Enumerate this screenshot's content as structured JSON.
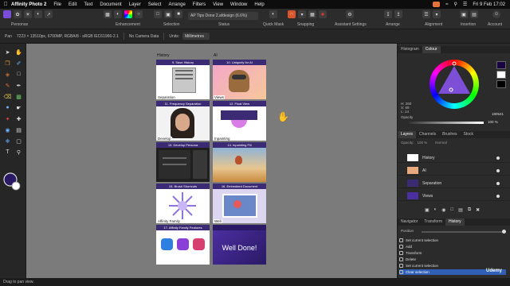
{
  "menubar": {
    "app_name": "Affinity Photo 2",
    "items": [
      "File",
      "Edit",
      "Text",
      "Document",
      "Layer",
      "Select",
      "Arrange",
      "Filters",
      "View",
      "Window",
      "Help"
    ],
    "datetime": "Fri 9 Feb  17:02"
  },
  "toolbar": {
    "personas_label": "Personas",
    "enhancement_label": "Enhancement",
    "selection_label": "Selection",
    "status_label": "Status",
    "quick_mask_label": "Quick Mask",
    "snapping_label": "Snapping",
    "assistant_label": "Assistant Settings",
    "arrange_label": "Arrange",
    "alignment_label": "Alignment",
    "insertion_label": "Insertion",
    "account_label": "Account",
    "document_status": "AP Tips Done 2.afdesign (6.6%)"
  },
  "context": {
    "tool": "Pan",
    "doc_info": "7223 × 13510px, 6700MP, RGBA/8 - sRGB IEC61966-2.1",
    "camera": "No Camera Data",
    "units_label": "Units:",
    "units_value": "Millimetres"
  },
  "canvas": {
    "columns": [
      "History",
      "AI"
    ],
    "cards": [
      {
        "header": "9. Save History",
        "caption": "Separation"
      },
      {
        "header": "10. Uniquely for AI",
        "caption": "Views"
      },
      {
        "header": "11. Frequency Separation",
        "caption": "Develop"
      },
      {
        "header": "12. Float View",
        "caption": "Inpainting"
      },
      {
        "header": "13. Develop Persona",
        "caption": ""
      },
      {
        "header": "14. Inpainting Fill",
        "caption": ""
      },
      {
        "header": "15. Brush Shortcuts",
        "caption": "Affinity Family"
      },
      {
        "header": "16. Embedded Document",
        "caption": "Well"
      },
      {
        "header": "17. Affinity Family Features",
        "caption": ""
      },
      {
        "header": "",
        "caption": "",
        "big_text": "Well Done!"
      }
    ]
  },
  "panels": {
    "top_tabs": [
      "Histogram",
      "Colour"
    ],
    "opacity_label": "Opacity",
    "opacity_value": "100 %",
    "color_hex": "180541",
    "hsl": [
      "H: 260",
      "S: 69",
      "L: 14"
    ],
    "layer_tabs": [
      "Layers",
      "Channels",
      "Brushes",
      "Stock"
    ],
    "layer_opacity_label": "Opacity:",
    "layer_opacity_value": "100 %",
    "blend_mode": "Normal",
    "layers": [
      "History",
      "AI",
      "Separation",
      "Views"
    ],
    "bottom_tabs": [
      "Navigator",
      "Transform",
      "History"
    ],
    "position_label": "Position",
    "history": [
      "Set current selection",
      "Add",
      "Transform",
      "Delete",
      "Set current selection",
      "Clear selection"
    ]
  },
  "status": {
    "hint": "Drag to pan view.",
    "watermark": "Udemy"
  },
  "colors": {
    "accent": "#3b2a74",
    "selection": "#2f5fb6",
    "canvas_bg": "#7b7b7b"
  }
}
